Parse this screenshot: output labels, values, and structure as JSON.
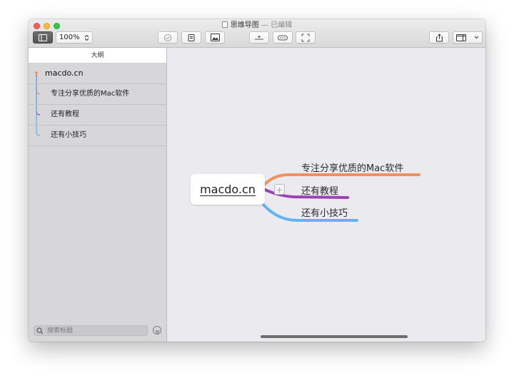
{
  "window": {
    "title": "思维导图",
    "separator": " — ",
    "status": "已编辑"
  },
  "toolbar": {
    "zoom": "100%",
    "icons": {
      "sidebar": "sidebar-toggle-icon",
      "zoom_stepper": "chevron-updown-icon",
      "check": "checkmark-icon",
      "note": "note-icon",
      "image": "image-icon",
      "insert": "insert-topic-icon",
      "more": "ellipsis-icon",
      "fit": "fit-to-window-icon",
      "share": "share-icon",
      "view": "view-panel-icon"
    }
  },
  "sidebar": {
    "header": "大纲",
    "root": "macdo.cn",
    "items": [
      {
        "label": "专注分享优质的Mac软件",
        "color": "#f0915c"
      },
      {
        "label": "还有教程",
        "color": "#9b43b5"
      },
      {
        "label": "还有小技巧",
        "color": "#62b3ee"
      }
    ],
    "search": {
      "placeholder": "搜索标题",
      "value": ""
    }
  },
  "map": {
    "central": "macdo.cn",
    "branches": [
      {
        "label": "专注分享优质的Mac软件",
        "color": "#f0915c"
      },
      {
        "label": "还有教程",
        "color": "#9b43b5"
      },
      {
        "label": "还有小技巧",
        "color": "#62b3ee"
      }
    ]
  },
  "colors": {
    "canvas_bg": "#ebeaef",
    "sidebar_bg": "#d7d7d9"
  }
}
